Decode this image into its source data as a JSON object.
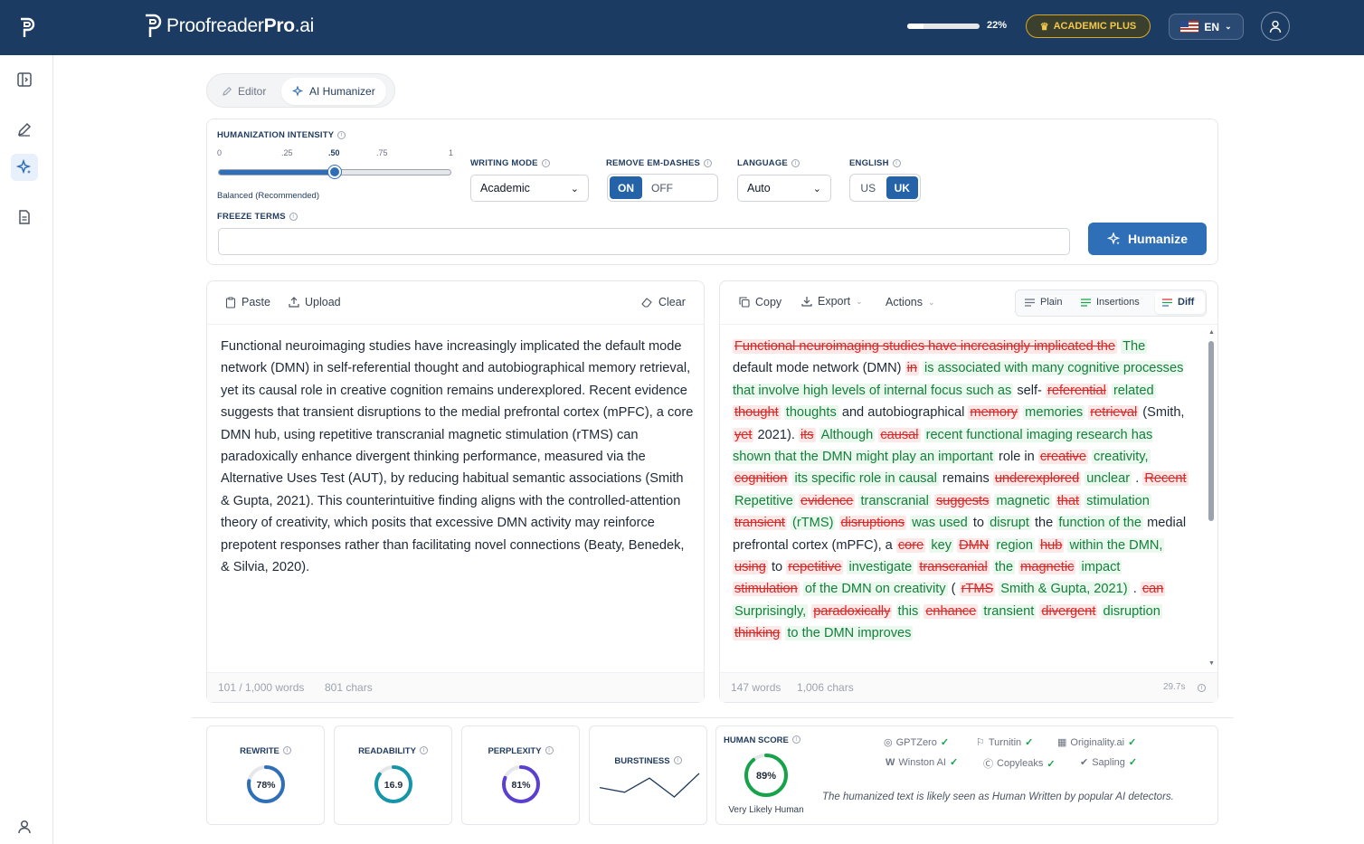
{
  "brand": {
    "name_light": "Proofreader",
    "name_bold": "Pro",
    "name_tail": ".ai"
  },
  "header": {
    "usage_percent_label": "22%",
    "usage_fraction": 0.22,
    "plan_badge": "ACADEMIC PLUS",
    "language": "EN"
  },
  "tabs": [
    {
      "label": "Editor"
    },
    {
      "label": "AI Humanizer"
    }
  ],
  "settings": {
    "intensity": {
      "label": "HUMANIZATION INTENSITY",
      "ticks": [
        "0",
        ".25",
        ".50",
        ".75",
        "1"
      ],
      "value": 0.5,
      "caption": "Balanced (Recommended)"
    },
    "writing_mode": {
      "label": "WRITING MODE",
      "value": "Academic"
    },
    "em_dashes": {
      "label": "REMOVE EM-DASHES",
      "on": "ON",
      "off": "OFF",
      "selected": "ON"
    },
    "language": {
      "label": "LANGUAGE",
      "value": "Auto"
    },
    "english": {
      "label": "ENGLISH",
      "us": "US",
      "uk": "UK",
      "selected": "UK"
    },
    "freeze": {
      "label": "FREEZE TERMS",
      "placeholder": ""
    },
    "humanize_button": "Humanize"
  },
  "input": {
    "paste": "Paste",
    "upload": "Upload",
    "clear": "Clear",
    "text": "Functional neuroimaging studies have increasingly implicated the default mode network (DMN) in self-referential thought and autobiographical memory retrieval, yet its causal role in creative cognition remains underexplored. Recent evidence suggests that transient disruptions to the medial prefrontal cortex (mPFC), a core DMN hub, using repetitive transcranial magnetic stimulation (rTMS) can paradoxically enhance divergent thinking performance, measured via the Alternative Uses Test (AUT), by reducing habitual semantic associations (Smith & Gupta, 2021). This counterintuitive finding aligns with the controlled-attention theory of creativity, which posits that excessive DMN activity may reinforce prepotent responses rather than facilitating novel connections (Beaty, Benedek, & Silvia, 2020).",
    "words": "101 / 1,000 words",
    "chars": "801 chars"
  },
  "output": {
    "copy": "Copy",
    "export": "Export",
    "actions": "Actions",
    "views": [
      "Plain",
      "Insertions",
      "Diff"
    ],
    "active_view": "Diff",
    "diff": [
      [
        "d",
        "Functional neuroimaging studies have increasingly implicated the"
      ],
      [
        "i",
        "The"
      ],
      [
        "n",
        "default mode network (DMN)"
      ],
      [
        "d",
        "in"
      ],
      [
        "i",
        "is associated with many cognitive processes that involve high levels of internal focus such as"
      ],
      [
        "n",
        "self-"
      ],
      [
        "d",
        "referential"
      ],
      [
        "i",
        "related"
      ],
      [
        "d",
        "thought"
      ],
      [
        "i",
        "thoughts"
      ],
      [
        "n",
        "and autobiographical"
      ],
      [
        "d",
        "memory"
      ],
      [
        "i",
        "memories"
      ],
      [
        "d",
        "retrieval"
      ],
      [
        "n",
        "(Smith,"
      ],
      [
        "d",
        "yet"
      ],
      [
        "n",
        "2021)."
      ],
      [
        "d",
        "its"
      ],
      [
        "i",
        "Although"
      ],
      [
        "d",
        "causal"
      ],
      [
        "i",
        "recent functional imaging research has shown that the DMN might play an important"
      ],
      [
        "n",
        "role in"
      ],
      [
        "d",
        "creative"
      ],
      [
        "i",
        "creativity,"
      ],
      [
        "d",
        "cognition"
      ],
      [
        "i",
        "its specific role in causal"
      ],
      [
        "n",
        "remains"
      ],
      [
        "d",
        "underexplored"
      ],
      [
        "i",
        "unclear"
      ],
      [
        "n",
        "."
      ],
      [
        "d",
        "Recent"
      ],
      [
        "i",
        "Repetitive"
      ],
      [
        "d",
        "evidence"
      ],
      [
        "i",
        "transcranial"
      ],
      [
        "d",
        "suggests"
      ],
      [
        "i",
        "magnetic"
      ],
      [
        "d",
        "that"
      ],
      [
        "i",
        "stimulation"
      ],
      [
        "d",
        "transient"
      ],
      [
        "i",
        "(rTMS)"
      ],
      [
        "d",
        "disruptions"
      ],
      [
        "i",
        "was used"
      ],
      [
        "n",
        "to"
      ],
      [
        "i",
        "disrupt"
      ],
      [
        "n",
        "the"
      ],
      [
        "i",
        "function of the"
      ],
      [
        "n",
        "medial prefrontal cortex (mPFC), a"
      ],
      [
        "d",
        "core"
      ],
      [
        "i",
        "key"
      ],
      [
        "d",
        "DMN"
      ],
      [
        "i",
        "region"
      ],
      [
        "d",
        "hub"
      ],
      [
        "i",
        "within the DMN,"
      ],
      [
        "d",
        "using"
      ],
      [
        "n",
        "to"
      ],
      [
        "d",
        "repetitive"
      ],
      [
        "i",
        "investigate"
      ],
      [
        "d",
        "transcranial"
      ],
      [
        "i",
        "the"
      ],
      [
        "d",
        "magnetic"
      ],
      [
        "i",
        "impact"
      ],
      [
        "d",
        "stimulation"
      ],
      [
        "i",
        "of the DMN on creativity"
      ],
      [
        "n",
        "("
      ],
      [
        "d",
        "rTMS"
      ],
      [
        "i",
        "Smith & Gupta, 2021)"
      ],
      [
        "n",
        "."
      ],
      [
        "d",
        "can"
      ],
      [
        "i",
        "Surprisingly,"
      ],
      [
        "d",
        "paradoxically"
      ],
      [
        "i",
        "this"
      ],
      [
        "d",
        "enhance"
      ],
      [
        "i",
        "transient"
      ],
      [
        "d",
        "divergent"
      ],
      [
        "i",
        "disruption"
      ],
      [
        "d",
        "thinking"
      ],
      [
        "i",
        "to the DMN improves"
      ]
    ],
    "words": "147 words",
    "chars": "1,006 chars",
    "time": "29.7s"
  },
  "metrics": {
    "rewrite": {
      "label": "REWRITE",
      "value": "78%",
      "fraction": 0.78,
      "color": "#2f6fb8"
    },
    "readability": {
      "label": "READABILITY",
      "value": "16.9",
      "fraction": 0.85,
      "color": "#1595a8"
    },
    "perplexity": {
      "label": "PERPLEXITY",
      "value": "81%",
      "fraction": 0.81,
      "color": "#5b3fd1"
    },
    "burstiness": {
      "label": "BURSTINESS",
      "series": [
        3,
        2,
        5,
        1,
        6
      ]
    },
    "human": {
      "label": "HUMAN SCORE",
      "value": "89%",
      "fraction": 0.89,
      "caption": "Very Likely Human",
      "color": "#16a34a"
    }
  },
  "detectors": [
    {
      "name": "GPTZero"
    },
    {
      "name": "Turnitin"
    },
    {
      "name": "Originality.ai"
    },
    {
      "name": "Winston AI"
    },
    {
      "name": "Copyleaks"
    },
    {
      "name": "Sapling"
    }
  ],
  "detector_note": "The humanized text is likely seen as Human Written by popular AI detectors."
}
